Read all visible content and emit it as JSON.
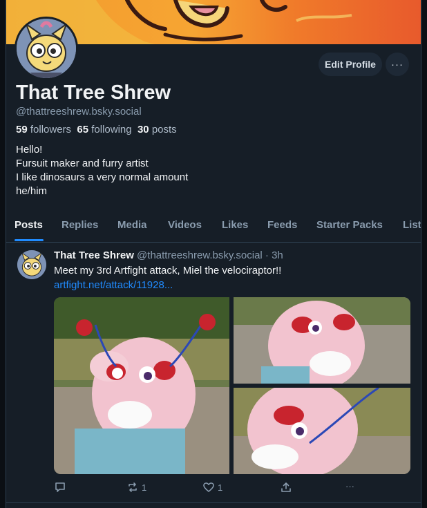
{
  "profile": {
    "display_name": "That Tree Shrew",
    "handle": "@thattreeshrew.bsky.social",
    "followers_count": "59",
    "followers_label": "followers",
    "following_count": "65",
    "following_label": "following",
    "posts_count": "30",
    "posts_label": "posts",
    "bio_lines": [
      "Hello!",
      "Fursuit maker and furry artist",
      "I like dinosaurs a very normal amount",
      "he/him"
    ],
    "edit_profile_label": "Edit Profile",
    "more_label": "···"
  },
  "tabs": [
    "Posts",
    "Replies",
    "Media",
    "Videos",
    "Likes",
    "Feeds",
    "Starter Packs",
    "List"
  ],
  "post": {
    "author_name": "That Tree Shrew",
    "author_handle": "@thattreeshrew.bsky.social",
    "separator": " · ",
    "time": "3h",
    "text": "Meet my 3rd Artfight attack, Miel the velociraptor!!",
    "link": "artfight.net/attack/11928...",
    "reply_count": "",
    "repost_count": "1",
    "like_count": "1",
    "more_label": "···"
  },
  "icons": {
    "reply": "speech-bubble-icon",
    "repost": "repost-arrows-icon",
    "like": "heart-icon",
    "share": "share-upload-icon",
    "more": "more-dots-icon"
  },
  "colors": {
    "background": "#161e27",
    "accent": "#208bfe",
    "muted_text": "#8a9cae"
  }
}
